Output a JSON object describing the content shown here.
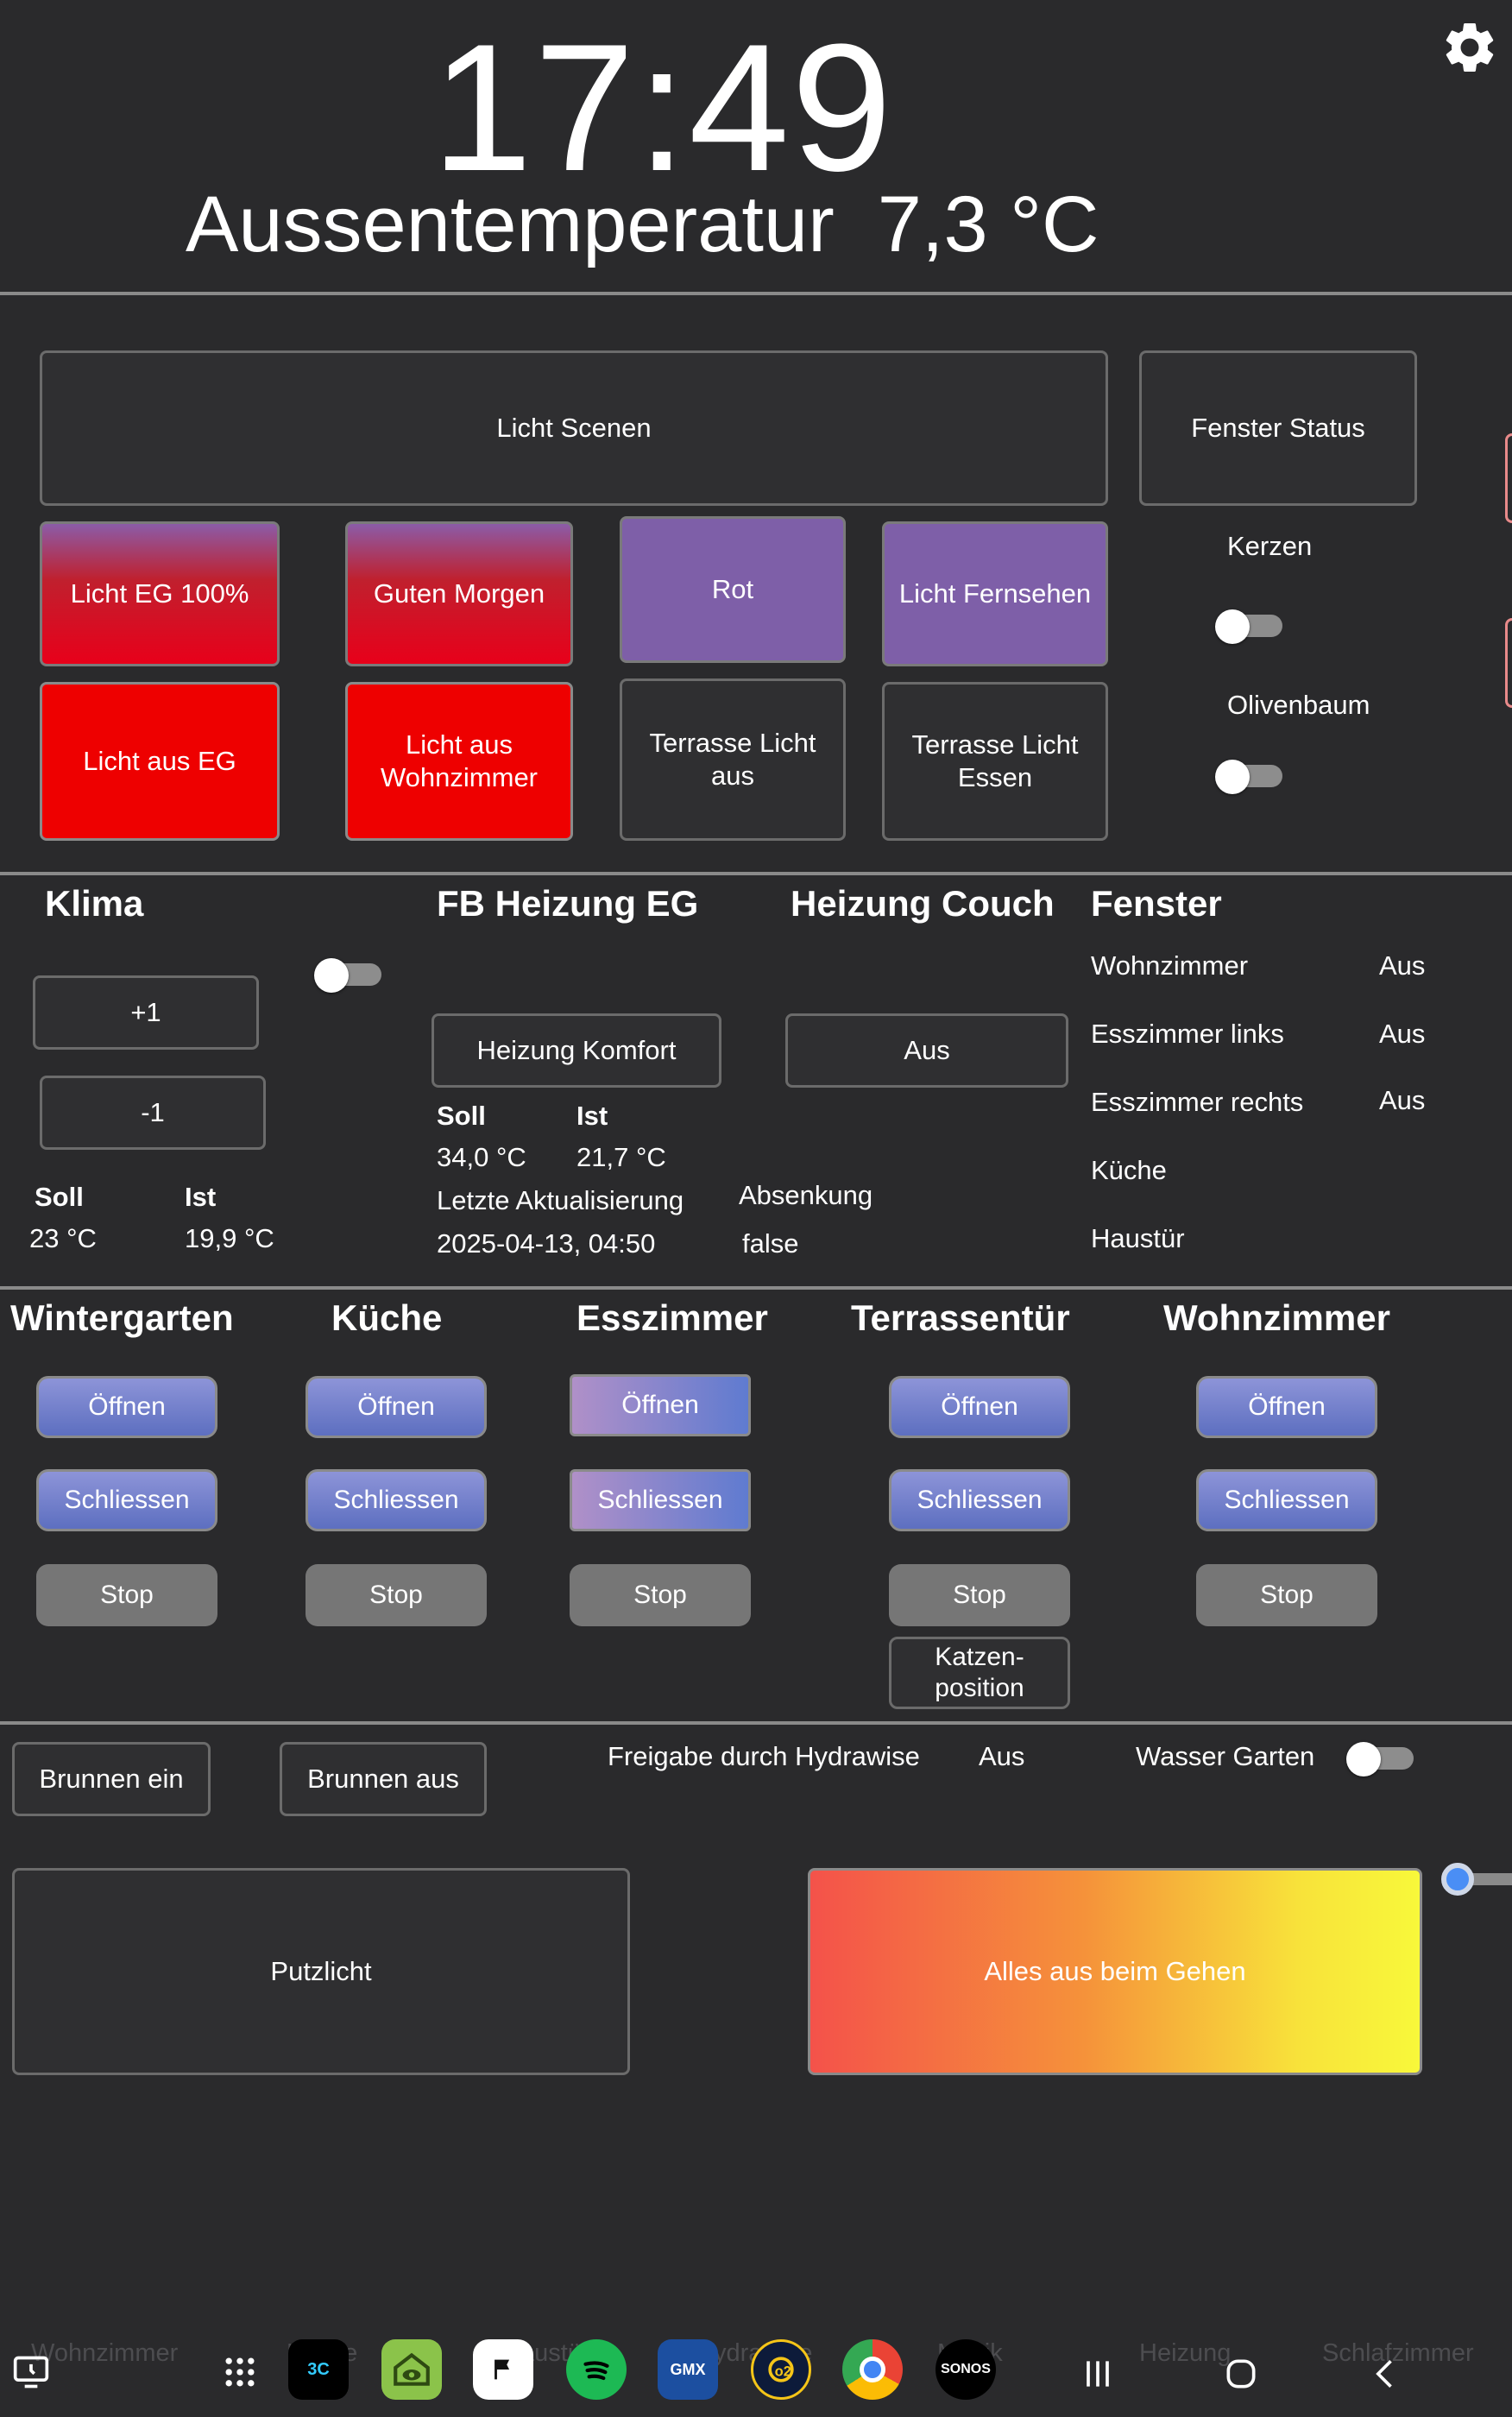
{
  "header": {
    "time": "17:49",
    "outside_label": "Aussentemperatur",
    "outside_value": "7,3 °C",
    "settings_icon": "gear-icon"
  },
  "scenes": {
    "title_button": "Licht Scenen",
    "fenster_status": "Fenster Status",
    "row1": [
      "Licht EG 100%",
      "Guten Morgen",
      "Rot",
      "Licht Fernsehen"
    ],
    "row2": [
      "Licht aus EG",
      "Licht aus Wohnzimmer",
      "Terrasse Licht aus",
      "Terrasse Licht Essen"
    ],
    "kerzen_label": "Kerzen",
    "olivenbaum_label": "Olivenbaum"
  },
  "klima": {
    "title": "Klima",
    "plus": "+1",
    "minus": "-1",
    "soll_label": "Soll",
    "ist_label": "Ist",
    "soll_value": "23 °C",
    "ist_value": "19,9 °C"
  },
  "fb_heizung": {
    "title": "FB Heizung EG",
    "mode_button": "Heizung Komfort",
    "soll_label": "Soll",
    "ist_label": "Ist",
    "soll_value": "34,0 °C",
    "ist_value": "21,7 °C",
    "update_label": "Letzte Aktualisierung",
    "update_value": "2025-04-13, 04:50"
  },
  "heizung_couch": {
    "title": "Heizung Couch",
    "button": "Aus",
    "absenkung_label": "Absenkung",
    "absenkung_value": "false"
  },
  "fenster": {
    "title": "Fenster",
    "rows": [
      {
        "name": "Wohnzimmer",
        "value": "Aus"
      },
      {
        "name": "Esszimmer links",
        "value": "Aus"
      },
      {
        "name": "Esszimmer rechts",
        "value": "Aus"
      },
      {
        "name": "Küche",
        "value": ""
      },
      {
        "name": "Haustür",
        "value": ""
      }
    ]
  },
  "rollos": {
    "open": "Öffnen",
    "close": "Schliessen",
    "stop": "Stop",
    "katzen": "Katzen-position",
    "rooms": [
      "Wintergarten",
      "Küche",
      "Esszimmer",
      "Terrassentür",
      "Wohnzimmer"
    ]
  },
  "garten": {
    "brunnen_ein": "Brunnen ein",
    "brunnen_aus": "Brunnen aus",
    "freigabe_label": "Freigabe durch Hydrawise",
    "freigabe_value": "Aus",
    "wasser_label": "Wasser Garten"
  },
  "bottom": {
    "putzlicht": "Putzlicht",
    "alles_aus": "Alles aus beim Gehen"
  },
  "navbar": {
    "ghost_tabs": [
      "Wohnzimmer",
      "Küche",
      "Haustür",
      "Hydrawise",
      "Musik",
      "Heizung",
      "Schlafzimmer"
    ],
    "apps": [
      "3C",
      "GMX",
      "SONOS"
    ]
  }
}
